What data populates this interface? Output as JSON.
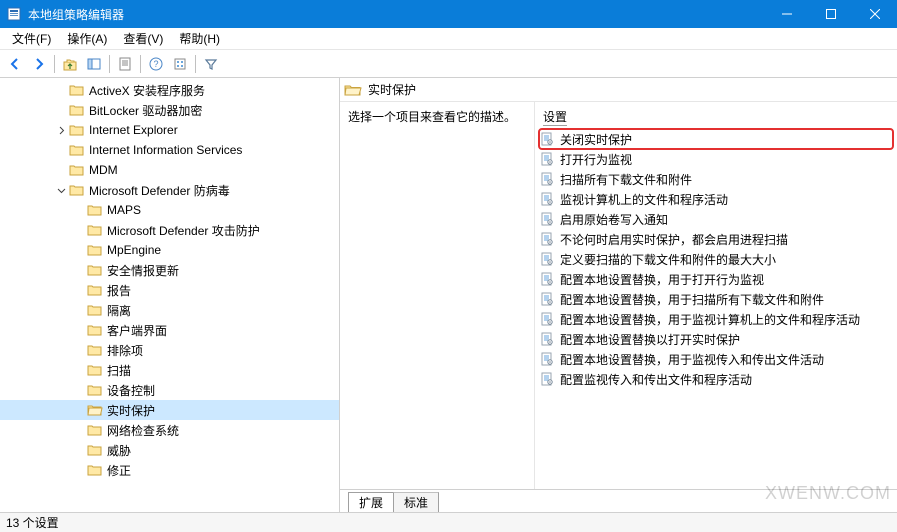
{
  "window": {
    "title": "本地组策略编辑器"
  },
  "menu": {
    "file": "文件(F)",
    "action": "操作(A)",
    "view": "查看(V)",
    "help": "帮助(H)"
  },
  "tree": {
    "items": [
      {
        "indent": 3,
        "exp": "none",
        "label": "ActiveX 安装程序服务"
      },
      {
        "indent": 3,
        "exp": "none",
        "label": "BitLocker 驱动器加密"
      },
      {
        "indent": 3,
        "exp": "closed",
        "label": "Internet Explorer"
      },
      {
        "indent": 3,
        "exp": "none",
        "label": "Internet Information Services"
      },
      {
        "indent": 3,
        "exp": "none",
        "label": "MDM"
      },
      {
        "indent": 3,
        "exp": "open",
        "label": "Microsoft Defender 防病毒"
      },
      {
        "indent": 4,
        "exp": "none",
        "label": "MAPS"
      },
      {
        "indent": 4,
        "exp": "none",
        "label": "Microsoft Defender 攻击防护"
      },
      {
        "indent": 4,
        "exp": "none",
        "label": "MpEngine"
      },
      {
        "indent": 4,
        "exp": "none",
        "label": "安全情报更新"
      },
      {
        "indent": 4,
        "exp": "none",
        "label": "报告"
      },
      {
        "indent": 4,
        "exp": "none",
        "label": "隔离"
      },
      {
        "indent": 4,
        "exp": "none",
        "label": "客户端界面"
      },
      {
        "indent": 4,
        "exp": "none",
        "label": "排除项"
      },
      {
        "indent": 4,
        "exp": "none",
        "label": "扫描"
      },
      {
        "indent": 4,
        "exp": "none",
        "label": "设备控制"
      },
      {
        "indent": 4,
        "exp": "none",
        "label": "实时保护",
        "selected": true,
        "open": true
      },
      {
        "indent": 4,
        "exp": "none",
        "label": "网络检查系统"
      },
      {
        "indent": 4,
        "exp": "none",
        "label": "威胁"
      },
      {
        "indent": 4,
        "exp": "none",
        "label": "修正"
      }
    ]
  },
  "right": {
    "header": "实时保护",
    "desc_prompt": "选择一个项目来查看它的描述。",
    "settings_header": "设置",
    "items": [
      {
        "label": "关闭实时保护",
        "hl": true
      },
      {
        "label": "打开行为监视"
      },
      {
        "label": "扫描所有下载文件和附件"
      },
      {
        "label": "监视计算机上的文件和程序活动"
      },
      {
        "label": "启用原始卷写入通知"
      },
      {
        "label": "不论何时启用实时保护，都会启用进程扫描"
      },
      {
        "label": "定义要扫描的下载文件和附件的最大大小"
      },
      {
        "label": "配置本地设置替换，用于打开行为监视"
      },
      {
        "label": "配置本地设置替换，用于扫描所有下载文件和附件"
      },
      {
        "label": "配置本地设置替换，用于监视计算机上的文件和程序活动"
      },
      {
        "label": "配置本地设置替换以打开实时保护"
      },
      {
        "label": "配置本地设置替换，用于监视传入和传出文件活动"
      },
      {
        "label": "配置监视传入和传出文件和程序活动"
      }
    ]
  },
  "tabs": {
    "extended": "扩展",
    "standard": "标准"
  },
  "status": "13 个设置",
  "watermark": "XWENW.COM"
}
